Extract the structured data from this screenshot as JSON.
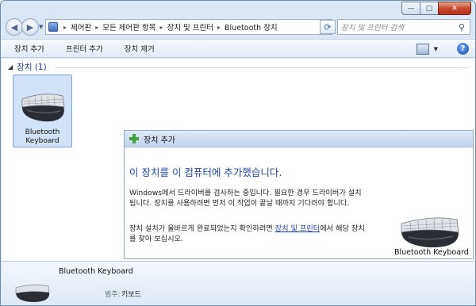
{
  "window": {
    "caption": {
      "min": "—",
      "max": "▢",
      "close": "✕"
    }
  },
  "nav": {
    "back": "◀",
    "forward": "▶",
    "breadcrumbs": [
      "제어판",
      "모든 제어판 항목",
      "장치 및 프린터",
      "Bluetooth 장치"
    ],
    "separator": "▸",
    "refresh": "⟳",
    "search_placeholder": "장치 및 프린터 검색",
    "search_glyph": "⚲"
  },
  "toolbar": {
    "add_device": "장치 추가",
    "add_printer": "프린터 추가",
    "remove_device": "장치 제거",
    "help": "?"
  },
  "content": {
    "group_caret": "◢",
    "group_label": "장치 (1)",
    "device_name_line1": "Bluetooth",
    "device_name_line2": "Keyboard"
  },
  "popup": {
    "title": "장치 추가",
    "heading": "이 장치를 이 컴퓨터에 추가했습니다.",
    "paragraph1": "Windows에서 드라이버를 검사하는 중입니다. 필요한 경우 드라이버가 설치됩니다. 장치를 사용하려면 먼저 이 작업이 끝날 때까지 기다려야 합니다.",
    "paragraph2_pre": "장치 설치가 올바르게 완료되었는지 확인하려면 ",
    "paragraph2_link": "장치 및 프린터",
    "paragraph2_post": "에서 해당 장치를 찾아 보십시오.",
    "device_label": "Bluetooth Keyboard"
  },
  "details": {
    "name": "Bluetooth Keyboard",
    "category_label": "범주:",
    "category_value": "키보드"
  },
  "colors": {
    "accent_blue": "#1f47a8",
    "link": "#1a3fb4",
    "selection": "#d3e3f7"
  }
}
